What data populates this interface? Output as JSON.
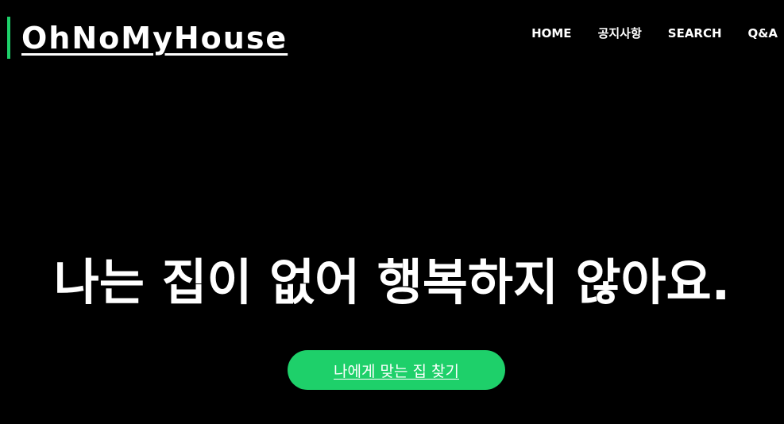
{
  "header": {
    "logo_text": "OhNoMyHouse",
    "nav": [
      {
        "label": "HOME"
      },
      {
        "label": "공지사항"
      },
      {
        "label": "SEARCH"
      },
      {
        "label": "Q&A"
      }
    ]
  },
  "hero": {
    "title": "나는 집이 없어 행복하지 않아요.",
    "cta_label": "나에게 맞는 집 찾기"
  },
  "colors": {
    "background": "#000000",
    "accent": "#1ed06a",
    "text": "#ffffff"
  }
}
